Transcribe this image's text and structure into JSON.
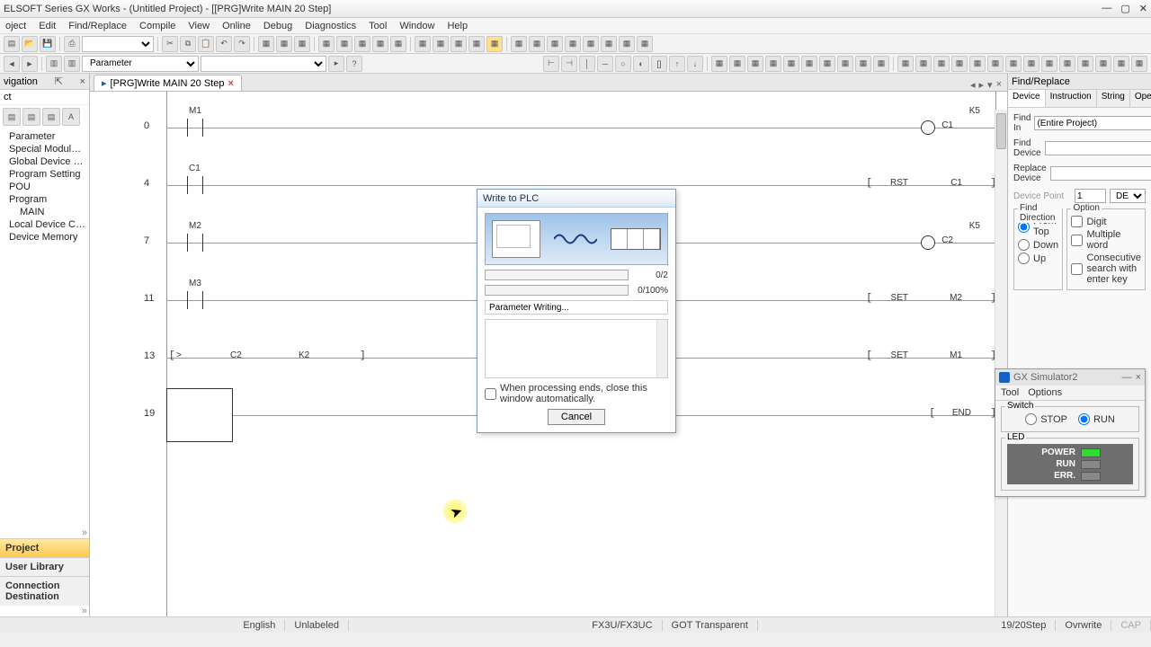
{
  "title": "ELSOFT Series GX Works - (Untitled Project) - [[PRG]Write MAIN 20 Step]",
  "menus": [
    "oject",
    "Edit",
    "Find/Replace",
    "Compile",
    "View",
    "Online",
    "Debug",
    "Diagnostics",
    "Tool",
    "Window",
    "Help"
  ],
  "param_selector": "Parameter",
  "navigation": {
    "header": "vigation",
    "section": "ct",
    "tree": [
      {
        "label": "Parameter"
      },
      {
        "label": "Special Module(Intelligent"
      },
      {
        "label": "Global Device Comment"
      },
      {
        "label": "Program Setting"
      },
      {
        "label": "POU"
      },
      {
        "label": "Program",
        "children": [
          {
            "label": "MAIN"
          }
        ]
      },
      {
        "label": "Local Device Commen"
      },
      {
        "label": "Device Memory"
      }
    ],
    "tabs": [
      "Project",
      "User Library",
      "Connection Destination"
    ],
    "active_tab": 0
  },
  "editor": {
    "tab_label": "[PRG]Write MAIN 20 Step",
    "rungs": [
      {
        "num": "0",
        "contact": "M1",
        "out_type": "coil",
        "out": "C1",
        "right": "K5"
      },
      {
        "num": "4",
        "contact": "C1",
        "out_type": "bracket",
        "out": "RST",
        "arg": "C1"
      },
      {
        "num": "7",
        "contact": "M2",
        "out_type": "coil",
        "out": "C2",
        "right": "K5"
      },
      {
        "num": "11",
        "contact": "M3",
        "out_type": "bracket",
        "out": "SET",
        "arg": "M2"
      },
      {
        "num": "13",
        "cmp": "> ",
        "a": "C2",
        "b": "K2",
        "out_type": "bracket",
        "out": "SET",
        "arg": "M1"
      },
      {
        "num": "19",
        "block": true,
        "out_type": "bracket",
        "out": "END"
      }
    ]
  },
  "find": {
    "hdr": "Find/Replace",
    "tabs": [
      "Device",
      "Instruction",
      "String",
      "Open/Close C"
    ],
    "active": 0,
    "find_in_label": "Find In",
    "find_in_value": "(Entire Project)",
    "find_device_label": "Find Device",
    "replace_device_label": "Replace Device",
    "device_point_label": "Device Point",
    "device_point_value": "1",
    "device_point_fmt": "DEC",
    "direction_legend": "Find Direction",
    "directions": [
      "From Top",
      "Down",
      "Up"
    ],
    "direction_sel": 0,
    "option_legend": "Option",
    "options": [
      "Digit",
      "Multiple word",
      "Consecutive search with enter key"
    ]
  },
  "dialog": {
    "title": "Write to PLC",
    "count": "0/2",
    "pct": "0/100%",
    "msg": "Parameter Writing...",
    "close_chk": "When processing ends, close this window automatically.",
    "cancel": "Cancel"
  },
  "sim": {
    "title": "GX Simulator2",
    "menus": [
      "Tool",
      "Options"
    ],
    "switch_legend": "Switch",
    "stop": "STOP",
    "run": "RUN",
    "run_sel": true,
    "led_legend": "LED",
    "leds": [
      {
        "name": "POWER",
        "on": true
      },
      {
        "name": "RUN",
        "on": false
      },
      {
        "name": "ERR.",
        "on": false
      }
    ]
  },
  "status": {
    "lang": "English",
    "label": "Unlabeled",
    "cpu": "FX3U/FX3UC",
    "got": "GOT Transparent",
    "step": "19/20Step",
    "ovr": "Ovrwrite",
    "cap": "CAP"
  }
}
